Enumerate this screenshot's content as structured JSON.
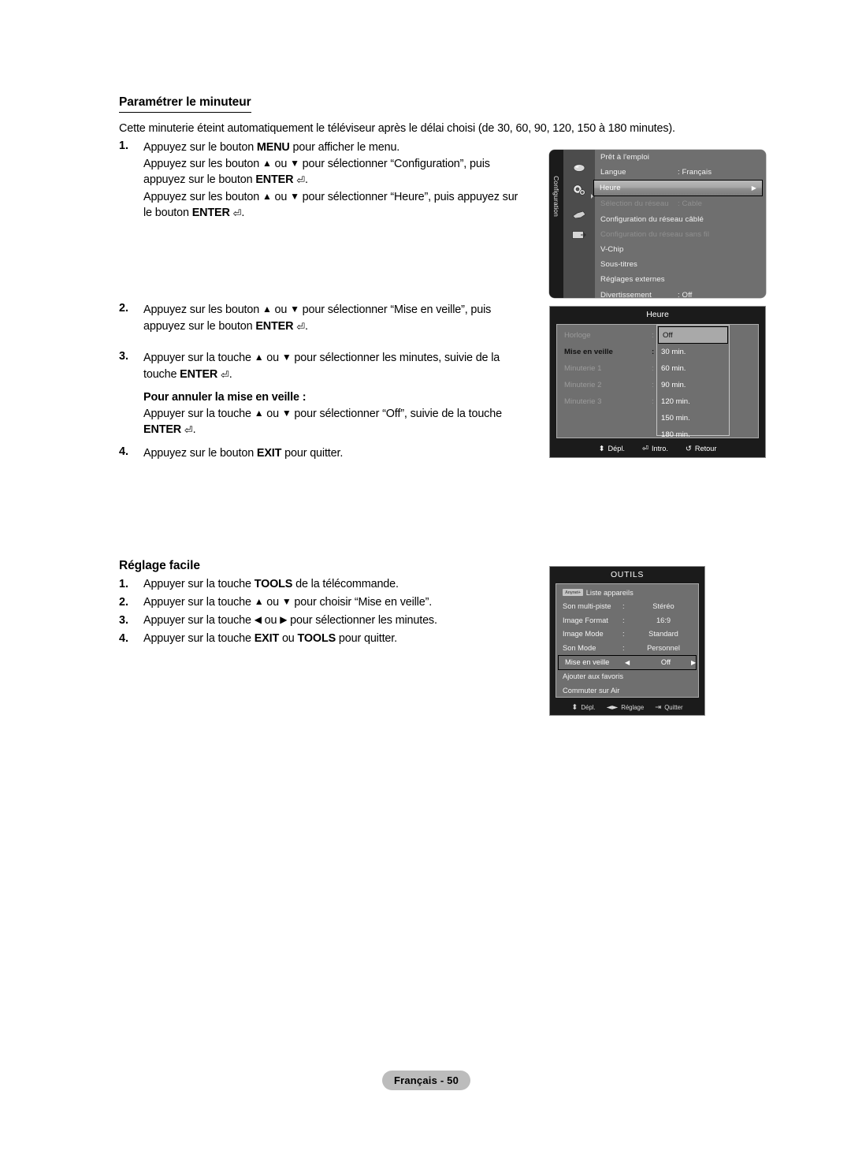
{
  "document": {
    "footer_label": "Français - 50"
  },
  "section1": {
    "title": "Paramétrer le minuteur",
    "intro": "Cette minuterie éteint automatiquement le téléviseur après le délai choisi (de 30, 60, 90, 120, 150 à 180 minutes).",
    "steps": [
      {
        "num": "1.",
        "lines": [
          "Appuyez sur le bouton MENU pour afficher le menu.",
          "Appuyez sur les bouton ▲ ou ▼ pour sélectionner “Configuration”, puis",
          "appuyez sur le bouton ENTER ↵.",
          "Appuyez sur les bouton ▲ ou ▼ pour sélectionner “Heure”, puis appuyez sur",
          "le bouton ENTER ↵."
        ]
      },
      {
        "num": "2.",
        "lines": [
          "Appuyez sur les bouton ▲ ou ▼ pour sélectionner “Mise en veille”, puis",
          "appuyez sur le bouton ENTER ↵."
        ]
      },
      {
        "num": "3.",
        "lines": [
          "Appuyer sur la touche ▲ ou ▼ pour sélectionner les minutes, suivie de la",
          "touche ENTER ↵.",
          "Pour annuler la mise en veille :",
          "Appuyer sur la touche ▲ ou ▼ pour sélectionner “Off”, suivie de la touche",
          "ENTER ↵."
        ],
        "subhead": "Pour annuler la mise en veille :"
      },
      {
        "num": "4.",
        "lines": [
          "Appuyez sur le bouton EXIT pour quitter."
        ]
      }
    ]
  },
  "section2": {
    "title": "Réglage facile",
    "steps": [
      {
        "num": "1.",
        "text": "Appuyer sur la touche TOOLS de la télécommande."
      },
      {
        "num": "2.",
        "text": "Appuyer sur la touche ▲ ou ▼ pour choisir “Mise en veille”."
      },
      {
        "num": "3.",
        "text": "Appuyer sur la touche ◀ ou ▶ pour sélectionner les minutes."
      },
      {
        "num": "4.",
        "text": "Appuyer sur la touche EXIT ou TOOLS pour quitter."
      }
    ]
  },
  "osd_config": {
    "side_label": "Configuration",
    "icons": [
      "picture-icon",
      "setup-gear-icon",
      "sound-icon",
      "input-icon"
    ],
    "rows": [
      {
        "label": "Prêt à l'emploi",
        "value": "",
        "state": "normal"
      },
      {
        "label": "Langue",
        "value": ": Français",
        "state": "normal"
      },
      {
        "label": "Heure",
        "value": "",
        "state": "selected"
      },
      {
        "label": "Sélection du réseau",
        "value": ": Cable",
        "state": "dim"
      },
      {
        "label": "Configuration du réseau câblé",
        "value": "",
        "state": "normal"
      },
      {
        "label": "Configuration du réseau sans fil",
        "value": "",
        "state": "dim"
      },
      {
        "label": "V-Chip",
        "value": "",
        "state": "normal"
      },
      {
        "label": "Sous-titres",
        "value": "",
        "state": "normal"
      },
      {
        "label": "Réglages externes",
        "value": "",
        "state": "normal"
      },
      {
        "label": "Divertissement",
        "value": ": Off",
        "state": "normal"
      }
    ]
  },
  "osd_heure": {
    "header": "Heure",
    "labels": [
      {
        "label": "Horloge",
        "strong": false
      },
      {
        "label": "Mise en veille",
        "strong": true
      },
      {
        "label": "Minuterie 1",
        "strong": false
      },
      {
        "label": "Minuterie 2",
        "strong": false
      },
      {
        "label": "Minuterie 3",
        "strong": false
      }
    ],
    "options": [
      "Off",
      "30 min.",
      "60 min.",
      "90 min.",
      "120 min.",
      "150 min.",
      "180 min."
    ],
    "selected_option": "Off",
    "footer": [
      {
        "icon": "updown-arrow-icon",
        "glyph": "⬍",
        "label": "Dépl."
      },
      {
        "icon": "enter-icon",
        "glyph": "↵",
        "label": "Intro."
      },
      {
        "icon": "return-icon",
        "glyph": "↺",
        "label": "Retour"
      }
    ]
  },
  "osd_outils": {
    "header": "OUTILS",
    "rows": [
      {
        "badge": "Anynet+",
        "label": "Liste appareils",
        "colon": "",
        "value": ""
      },
      {
        "badge": "",
        "label": "Son multi-piste",
        "colon": ":",
        "value": "Stéréo"
      },
      {
        "badge": "",
        "label": "Image Format",
        "colon": ":",
        "value": "16:9"
      },
      {
        "badge": "",
        "label": "Image Mode",
        "colon": ":",
        "value": "Standard"
      },
      {
        "badge": "",
        "label": "Son Mode",
        "colon": ":",
        "value": "Personnel"
      },
      {
        "badge": "",
        "label": "Mise en veille",
        "colon": "",
        "value": "Off",
        "selected": true
      },
      {
        "badge": "",
        "label": "Ajouter aux favoris",
        "colon": "",
        "value": ""
      },
      {
        "badge": "",
        "label": "Commuter sur Air",
        "colon": "",
        "value": ""
      }
    ],
    "footer": [
      {
        "icon": "updown-arrow-icon",
        "glyph": "⬍",
        "label": "Dépl."
      },
      {
        "icon": "leftright-arrow-icon",
        "glyph": "◄►",
        "label": "Réglage"
      },
      {
        "icon": "exit-icon",
        "glyph": "⇥",
        "label": "Quitter"
      }
    ]
  }
}
